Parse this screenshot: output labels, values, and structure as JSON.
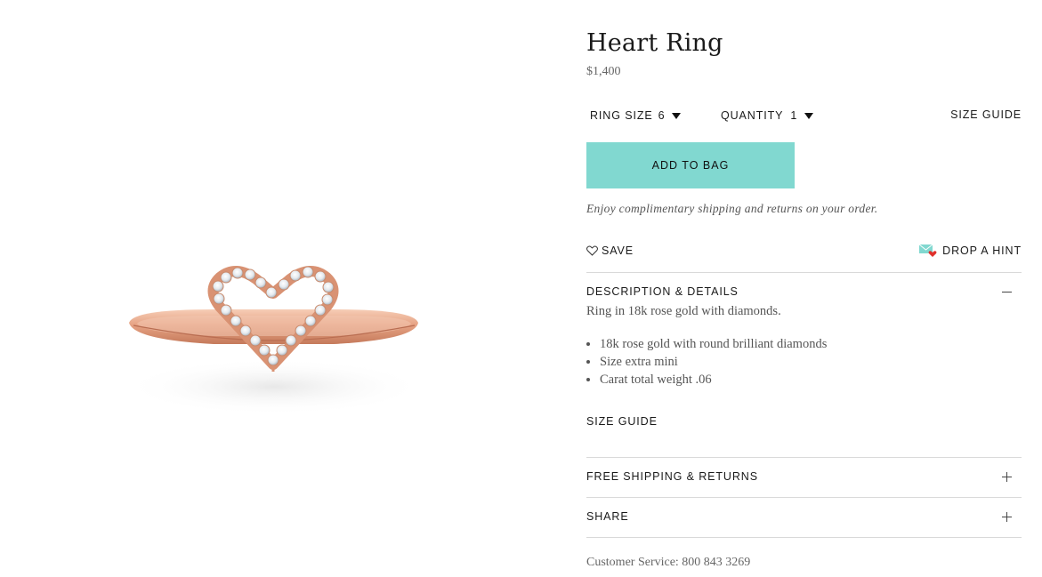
{
  "product": {
    "title": "Heart Ring",
    "price": "$1,400",
    "image_alt": "Rose gold heart ring with diamonds"
  },
  "options": {
    "ring_size_label": "RING SIZE",
    "ring_size_value": "6",
    "quantity_label": "QUANTITY",
    "quantity_value": "1",
    "size_guide_label": "SIZE GUIDE"
  },
  "actions": {
    "add_to_bag": "ADD TO BAG",
    "shipping_note": "Enjoy complimentary shipping and returns on your order.",
    "save_label": "SAVE",
    "hint_label": "DROP A HINT"
  },
  "sections": {
    "description": {
      "heading": "DESCRIPTION & DETAILS",
      "text": "Ring in 18k rose gold with diamonds.",
      "bullets": [
        "18k rose gold with round brilliant diamonds",
        "Size extra mini",
        "Carat total weight .06"
      ],
      "size_guide": "SIZE GUIDE"
    },
    "shipping": {
      "heading": "FREE SHIPPING & RETURNS"
    },
    "share": {
      "heading": "SHARE"
    }
  },
  "footer": {
    "customer_service": "Customer Service: 800 843 3269"
  },
  "colors": {
    "accent": "#81d8d0",
    "rose_gold": "#e9a688",
    "hint_heart": "#e0312c"
  },
  "icons": {
    "save": "heart-outline-icon",
    "hint": "envelope-heart-icon",
    "dropdown": "caret-down-icon",
    "expanded": "minus-icon",
    "collapsed": "plus-icon"
  }
}
